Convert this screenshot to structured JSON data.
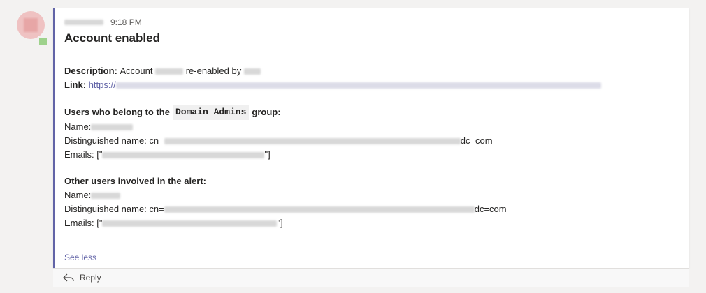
{
  "message": {
    "sender_redacted": true,
    "time": "9:18 PM",
    "title": "Account enabled",
    "description_label": "Description:",
    "description_prefix": "Account",
    "description_middle": "re-enabled by",
    "link_label": "Link:",
    "link_prefix": "https://",
    "domain_admins": {
      "heading_prefix": "Users who belong to the",
      "group_name": "Domain Admins",
      "heading_suffix": "group:",
      "name_label": "Name:",
      "dn_label": "Distinguished name: cn=",
      "dn_suffix": "dc=com",
      "emails_prefix": "Emails: [\"",
      "emails_suffix": "\"]"
    },
    "other_users": {
      "heading": "Other users involved in the alert:",
      "name_label": "Name:",
      "dn_label": "Distinguished name: cn=",
      "dn_suffix": "dc=com",
      "emails_prefix": "Emails: [\"",
      "emails_suffix": "\"]"
    },
    "see_less": "See less",
    "reply": "Reply"
  },
  "colors": {
    "accent": "#6264a7",
    "background": "#f3f2f1",
    "card": "#ffffff"
  }
}
